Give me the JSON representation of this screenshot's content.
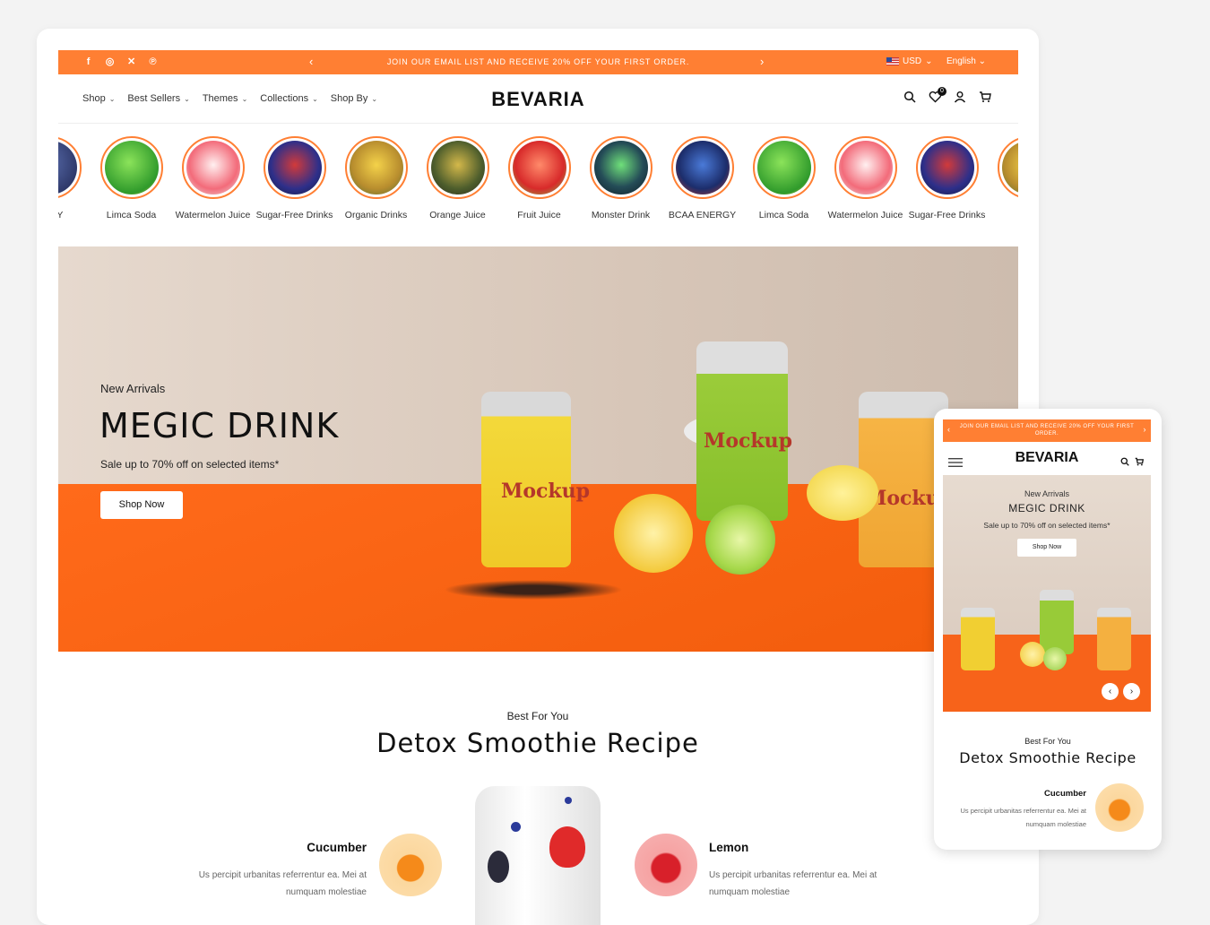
{
  "topbar": {
    "message": "JOIN OUR EMAIL LIST AND RECEIVE 20% OFF YOUR FIRST ORDER.",
    "currency": "USD",
    "language": "English",
    "social": [
      "facebook-icon",
      "instagram-icon",
      "x-icon",
      "pinterest-icon"
    ]
  },
  "nav": {
    "logo": "BEVARIA",
    "menu": [
      "Shop",
      "Best Sellers",
      "Themes",
      "Collections",
      "Shop By"
    ],
    "wishlist_count": "0"
  },
  "categories": [
    {
      "label": "ERGY",
      "color": "#2a3a6b"
    },
    {
      "label": "Limca Soda",
      "color": "#3fbf3a"
    },
    {
      "label": "Watermelon Juice",
      "color": "#f07080"
    },
    {
      "label": "Sugar-Free Drinks",
      "color": "#3a3fa0"
    },
    {
      "label": "Organic Drinks",
      "color": "#c9a83a"
    },
    {
      "label": "Orange Juice",
      "color": "#5a6a35"
    },
    {
      "label": "Fruit Juice",
      "color": "#e33a3a"
    },
    {
      "label": "Monster Drink",
      "color": "#2e5560"
    },
    {
      "label": "BCAA ENERGY",
      "color": "#243a7a"
    },
    {
      "label": "Limca Soda",
      "color": "#3fbf3a"
    },
    {
      "label": "Watermelon Juice",
      "color": "#f07080"
    },
    {
      "label": "Sugar-Free Drinks",
      "color": "#3a3fa0"
    },
    {
      "label": "Orga",
      "color": "#c9a83a"
    }
  ],
  "hero": {
    "eyebrow": "New Arrivals",
    "title": "MEGIC DRINK",
    "subtitle": "Sale up to 70% off on selected items*",
    "button": "Shop Now"
  },
  "section": {
    "eyebrow": "Best For You",
    "title": "Detox Smoothie Recipe",
    "items": [
      {
        "name": "Cucumber",
        "desc": "Us percipit urbanitas referrentur ea. Mei at numquam molestiae"
      },
      {
        "name": "Lemon",
        "desc": "Us percipit urbanitas referrentur ea. Mei at numquam molestiae"
      }
    ]
  },
  "mobile": {
    "message": "JOIN OUR EMAIL LIST AND RECEIVE 20% OFF YOUR FIRST ORDER.",
    "logo": "BEVARIA",
    "hero_eyebrow": "New Arrivals",
    "hero_title": "MEGIC DRINK",
    "hero_subtitle": "Sale up to 70% off on selected items*",
    "hero_button": "Shop Now",
    "section_eyebrow": "Best For You",
    "section_title": "Detox Smoothie Recipe",
    "item_name": "Cucumber",
    "item_desc": "Us percipit urbanitas referrentur ea. Mei at numquam molestiae"
  },
  "colors": {
    "accent": "#ff7f33",
    "dark": "#111111"
  }
}
